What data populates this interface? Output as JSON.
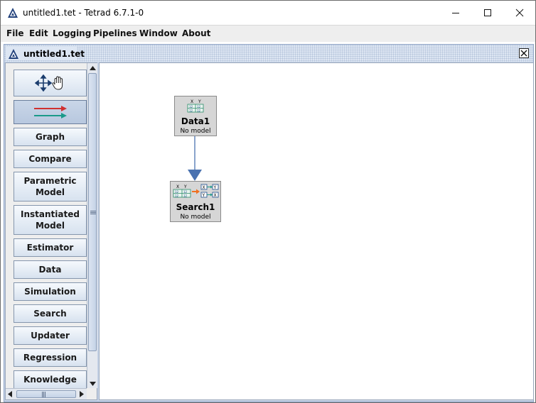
{
  "window": {
    "title": "untitled1.tet - Tetrad 6.7.1-0"
  },
  "menu": [
    "File",
    "Edit",
    "Logging",
    "Pipelines",
    "Window",
    "About"
  ],
  "document": {
    "title": "untitled1.tet"
  },
  "palette": {
    "buttons": [
      {
        "label": "",
        "icon": "move-select-icon"
      },
      {
        "label": "",
        "icon": "flow-arrow-icon"
      },
      {
        "label": "Graph"
      },
      {
        "label": "Compare"
      },
      {
        "label": "Parametric Model"
      },
      {
        "label": "Instantiated Model"
      },
      {
        "label": "Estimator"
      },
      {
        "label": "Data"
      },
      {
        "label": "Simulation"
      },
      {
        "label": "Search"
      },
      {
        "label": "Updater"
      },
      {
        "label": "Regression"
      },
      {
        "label": "Knowledge"
      }
    ]
  },
  "nodes": [
    {
      "name": "Data1",
      "model": "No model",
      "icon": "data-table-icon",
      "header": "X Y"
    },
    {
      "name": "Search1",
      "model": "No model",
      "icon": "search-graph-icon",
      "header": "X Y"
    }
  ],
  "colors": {
    "accent": "#4a72b0",
    "arrow_red": "#d03030",
    "arrow_teal": "#1a9a8a",
    "search_arrow": "#f07020"
  }
}
